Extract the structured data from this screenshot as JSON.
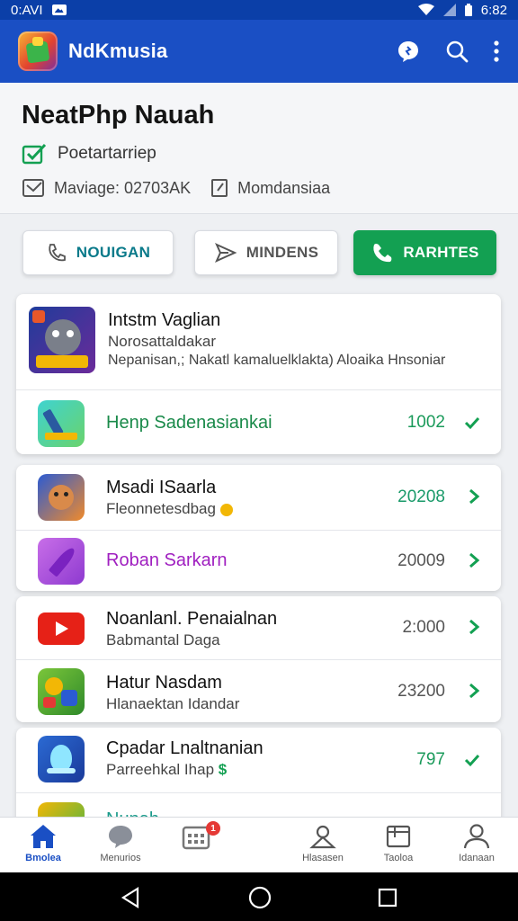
{
  "status_bar": {
    "time": "0:AVI",
    "clock": "6:82"
  },
  "app_bar": {
    "title": "NdKmusia"
  },
  "header": {
    "title": "NeatPhp Nauah",
    "checked_label": "Poetartarriep",
    "meta_left": "Maviage: 02703AK",
    "meta_right": "Momdansiaa"
  },
  "action_buttons": [
    {
      "label": "NOUIGAN",
      "icon": "phone-outline-icon"
    },
    {
      "label": "MINDENS",
      "icon": "send-icon"
    },
    {
      "label": "RARHTES",
      "icon": "phone-icon"
    }
  ],
  "cards": [
    {
      "featured": {
        "title": "Intstm Vaglian",
        "subtitle": "Norosattaldakar",
        "description": "Nepanisan,; Nakatl kamaluelklakta) Aloaika Hnsoniar"
      },
      "rows": [
        {
          "title": "Henp Sadenasiankai",
          "value": "1002",
          "value_color": "#1a9a5a"
        }
      ]
    },
    {
      "rows": [
        {
          "title": "Msadi ISaarla",
          "subtitle": "Fleonnetesdbag",
          "value": "20208",
          "value_color": "#1a9a6a"
        },
        {
          "title": "Roban Sarkarn",
          "value": "20009",
          "value_color": "#555555",
          "title_color": "#a020c0"
        }
      ]
    },
    {
      "rows": [
        {
          "title": "Noanlanl. Penaialnan",
          "subtitle": "Babmantal Daga",
          "value": "2:000",
          "value_color": "#555555"
        },
        {
          "title": "Hatur Nasdam",
          "subtitle": "Hlanaektan Idandar",
          "value": "23200",
          "value_color": "#555555"
        }
      ]
    },
    {
      "rows": [
        {
          "title": "Cpadar Lnaltnanian",
          "subtitle": "Parreehkal Ihap",
          "value": "797",
          "value_color": "#1a9a5a"
        },
        {
          "title": "Nunah"
        }
      ]
    }
  ],
  "bottom_nav": [
    {
      "label": "Bmolea",
      "active": true
    },
    {
      "label": "Menurios"
    },
    {
      "label": "",
      "badge": "1"
    },
    {
      "label": "Hlasasen"
    },
    {
      "label": "Taoloa"
    },
    {
      "label": "Idanaan"
    }
  ],
  "colors": {
    "primary": "#1a4fc4",
    "accent_green": "#13a052",
    "status_bar": "#0b3fa8"
  }
}
